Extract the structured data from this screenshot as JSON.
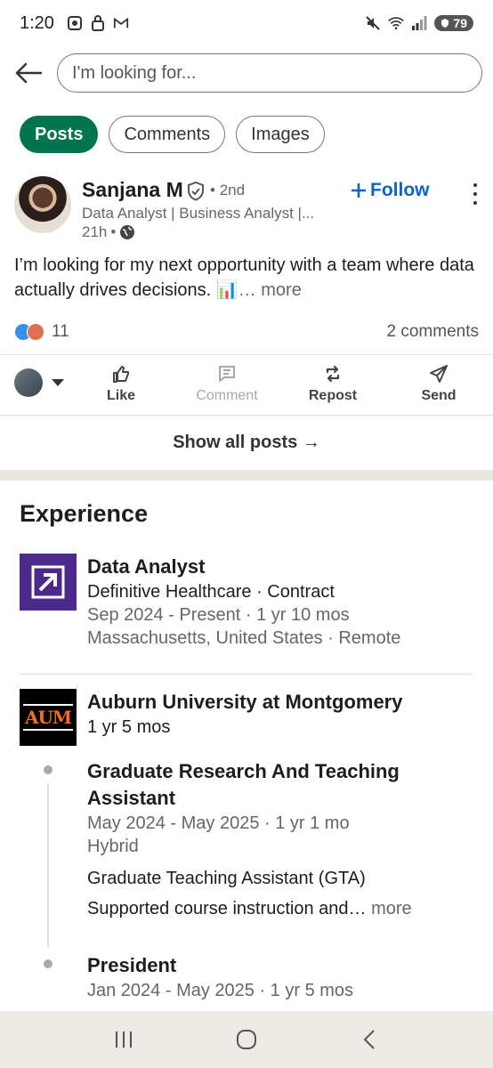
{
  "status_bar": {
    "time": "1:20",
    "battery": "79",
    "icons": [
      "screenshot-icon",
      "lock-icon",
      "gmail-icon",
      "mute-icon",
      "wifi-icon",
      "signal-icon",
      "battery-icon"
    ]
  },
  "search": {
    "placeholder": "I'm looking for..."
  },
  "filters": {
    "items": [
      {
        "label": "Posts",
        "active": true
      },
      {
        "label": "Comments",
        "active": false
      },
      {
        "label": "Images",
        "active": false
      }
    ]
  },
  "post": {
    "author": "Sanjana M",
    "degree": "2nd",
    "headline": "Data Analyst | Business Analyst |...",
    "time": "21h",
    "follow_label": "Follow",
    "text": "I’m looking for my next opportunity with a team where data actually drives decisions.",
    "emoji": "📊",
    "more_label": "… more",
    "reaction_count": "11",
    "comments_count": "2 comments",
    "actions": {
      "like": "Like",
      "comment": "Comment",
      "repost": "Repost",
      "send": "Send"
    }
  },
  "show_all_label": "Show all posts →",
  "experience": {
    "title": "Experience",
    "job1": {
      "role": "Data Analyst",
      "company": "Definitive Healthcare · Contract",
      "dates": "Sep 2024 - Present · 1 yr 10 mos",
      "location": "Massachusetts, United States · Remote"
    },
    "job2": {
      "company": "Auburn University at Montgomery",
      "logo_text": "AUM",
      "duration": "1 yr 5 mos",
      "roles": [
        {
          "title": "Graduate Research And Teaching Assistant",
          "dates": "May 2024 - May 2025 · 1 yr 1 mo",
          "location": "Hybrid",
          "subtitle": "Graduate Teaching Assistant (GTA)",
          "description": "Supported course instruction and…",
          "more": "more"
        },
        {
          "title": "President",
          "dates": "Jan 2024 - May 2025 · 1 yr 5 mos"
        }
      ]
    }
  },
  "colors": {
    "accent_green": "#01754f",
    "link_blue": "#0a66c2",
    "nav_bg": "#ede9e4"
  }
}
